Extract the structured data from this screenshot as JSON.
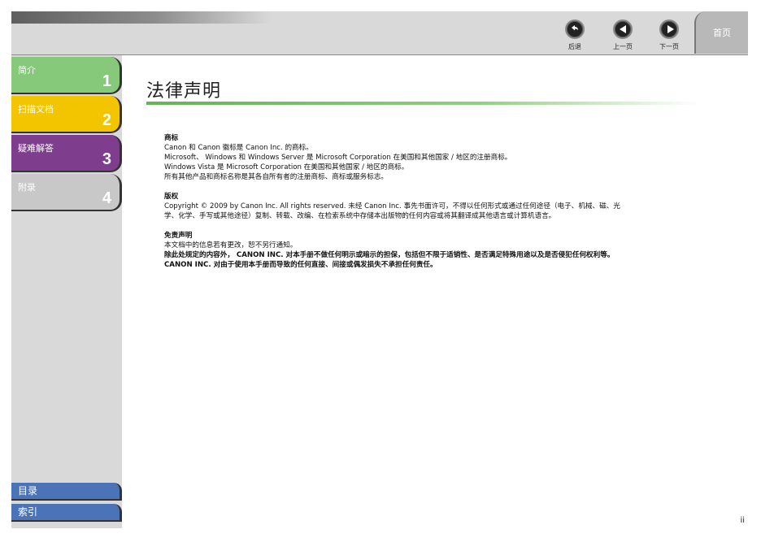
{
  "toolbar": {
    "back_label": "后退",
    "prev_label": "上一页",
    "next_label": "下一页",
    "home_label": "首页"
  },
  "sidebar": {
    "tabs": [
      {
        "label": "简介",
        "number": "1",
        "color": "#86c97a"
      },
      {
        "label": "扫描文档",
        "number": "2",
        "color": "#f3c400"
      },
      {
        "label": "疑难解答",
        "number": "3",
        "color": "#7f3d8e"
      },
      {
        "label": "附录",
        "number": "4",
        "color": "#c8c8c8"
      }
    ],
    "contents_label": "目录",
    "index_label": "索引"
  },
  "main": {
    "title": "法律声明",
    "sections": {
      "trademarks": {
        "heading": "商标",
        "lines": [
          "Canon 和 Canon 徽标是 Canon Inc. 的商标。",
          "Microsoft、 Windows 和 Windows Server 是 Microsoft Corporation 在美国和其他国家 / 地区的注册商标。",
          "Windows Vista 是 Microsoft Corporation 在美国和其他国家 / 地区的商标。",
          "所有其他产品和商标名称是其各自所有者的注册商标、商标或服务标志。"
        ]
      },
      "copyright": {
        "heading": "版权",
        "lines": [
          "Copyright © 2009 by Canon Inc. All rights reserved. 未经 Canon Inc. 事先书面许可，不得以任何形式或通过任何途径（电子、机械、磁、光",
          "学、化学、手写或其他途径）复制、转载、改编、在检索系统中存储本出版物的任何内容或将其翻译成其他语言或计算机语言。"
        ]
      },
      "disclaimer": {
        "heading": "免责声明",
        "lines": [
          "本文档中的信息若有更改，恕不另行通知。"
        ],
        "bold_lines": [
          "除此处规定的内容外， CANON INC. 对本手册不做任何明示或暗示的担保，包括但不限于适销性、是否满足特殊用途以及是否侵犯任何权利等。",
          "CANON INC. 对由于使用本手册而导致的任何直接、间接或偶发损失不承担任何责任。"
        ]
      }
    }
  },
  "page_number": "ii",
  "colors": {
    "accent_green": "#86c97a",
    "accent_yellow": "#f3c400",
    "accent_purple": "#7f3d8e",
    "link_blue": "#4a73b8"
  }
}
